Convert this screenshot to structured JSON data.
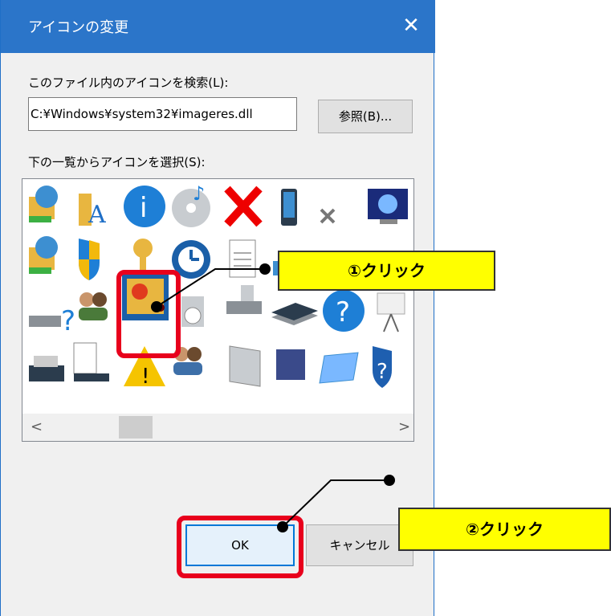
{
  "dialog": {
    "title": "アイコンの変更",
    "close_glyph": "✕",
    "search_label": "このファイル内のアイコンを検索(L):",
    "file_path": "C:¥Windows¥system32¥imageres.dll",
    "browse_label": "参照(B)...",
    "list_label": "下の一覧からアイコンを選択(S):",
    "ok_label": "OK",
    "cancel_label": "キャンセル"
  },
  "scrollbar": {
    "left_arrow": "<",
    "right_arrow": ">"
  },
  "icons": [
    "network-folder-icon",
    "font-folder-icon",
    "info-icon",
    "cd-audio-icon",
    "red-x-icon",
    "phone-icon",
    "small-x-icon",
    "monitor-icon",
    "network-folder2-icon",
    "shield-icon",
    "key-icon",
    "clock-icon",
    "document-icon",
    "window-icon",
    "red-stop-icon",
    "folder-icon",
    "network-drive-icon",
    "users-icon",
    "photo-icon",
    "media-icon",
    "drive-icon",
    "scanner-icon",
    "help-icon",
    "projector-icon",
    "printer-icon",
    "checklist-icon",
    "warning-icon",
    "users2-icon",
    "panel-icon",
    "cube-icon",
    "card-icon",
    "shield-help-icon"
  ],
  "annotations": {
    "callout1": "①クリック",
    "callout2": "②クリック"
  },
  "colors": {
    "titlebar": "#2b75c9",
    "highlight": "#e8001c",
    "callout": "#ffff00"
  }
}
